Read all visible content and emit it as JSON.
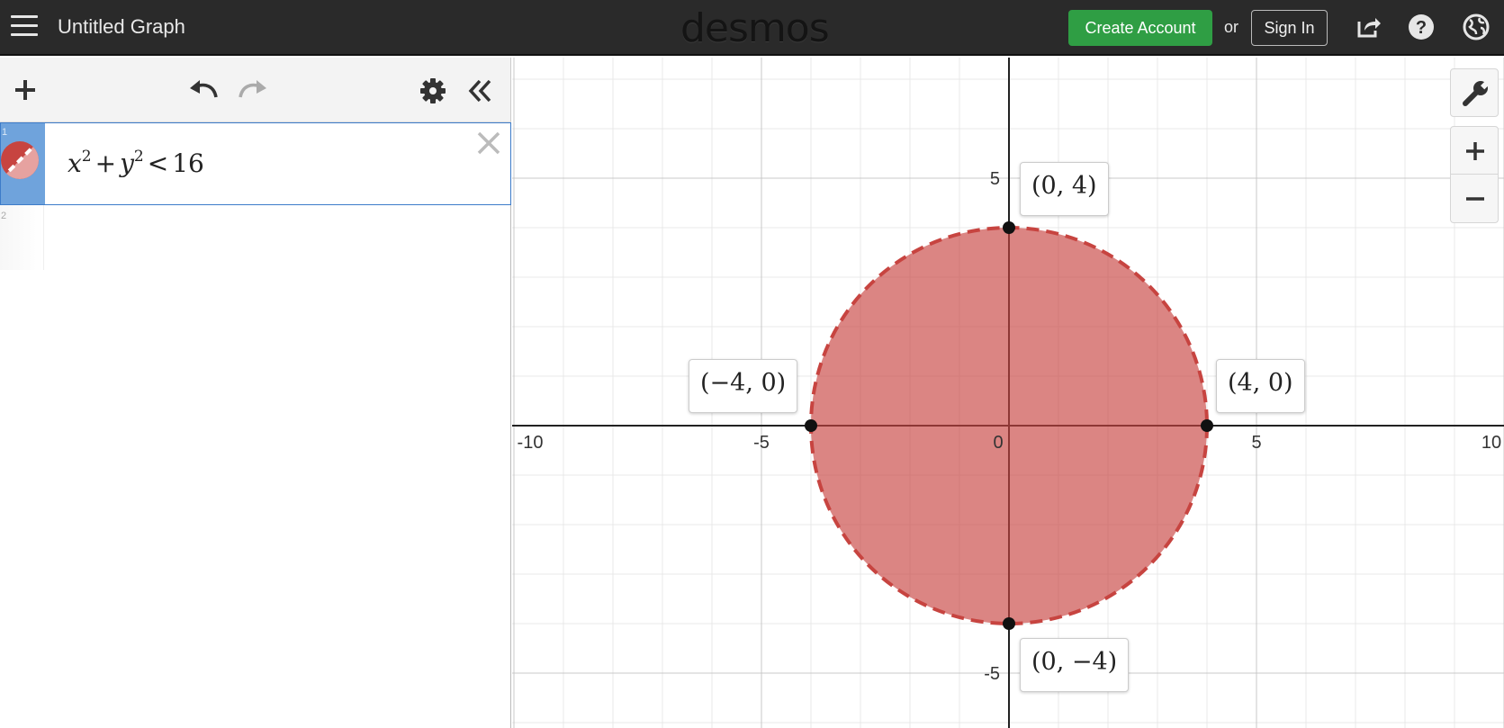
{
  "header": {
    "graph_title": "Untitled Graph",
    "logo": "desmos",
    "create_account": "Create Account",
    "or": "or",
    "sign_in": "Sign In",
    "icons": [
      "menu-icon",
      "share-icon",
      "help-icon",
      "language-icon"
    ]
  },
  "expressions": {
    "items": [
      {
        "number": "1",
        "latex": {
          "x": "x",
          "x_exp": "2",
          "plus": "+",
          "y": "y",
          "y_exp": "2",
          "op": "<",
          "rhs": "16"
        },
        "color": "#c74440"
      },
      {
        "number": "2",
        "latex": null
      }
    ]
  },
  "graph": {
    "x_ticks": [
      "-10",
      "-5",
      "0",
      "5",
      "10"
    ],
    "y_ticks": [
      "5",
      "-5"
    ],
    "points": [
      {
        "label": "(0, 4)"
      },
      {
        "label": "(−4, 0)"
      },
      {
        "label": "(4, 0)"
      },
      {
        "label": "(0, −4)"
      }
    ]
  },
  "colors": {
    "fill": "#c74440",
    "accent": "#2f9e44",
    "topbar": "#2a2a2a"
  }
}
